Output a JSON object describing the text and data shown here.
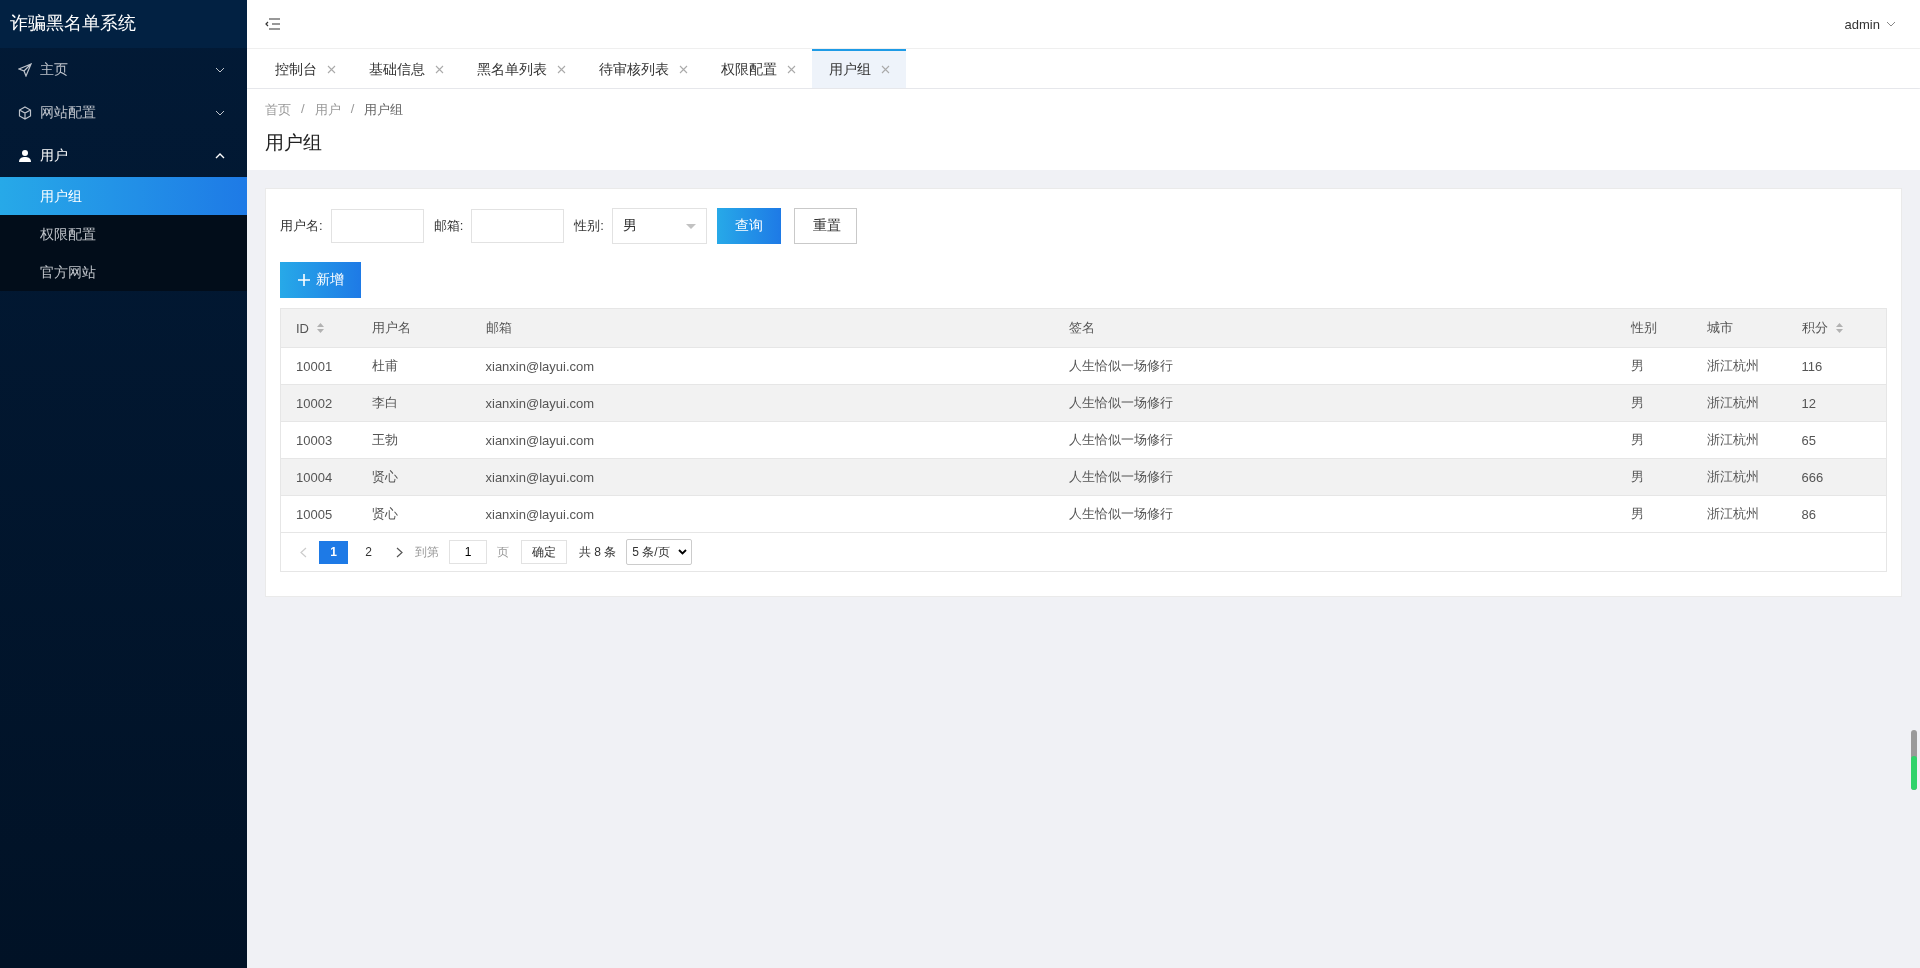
{
  "app": {
    "title": "诈骗黑名单系统"
  },
  "sidebar": {
    "items": [
      {
        "label": "主页",
        "expanded": false
      },
      {
        "label": "网站配置",
        "expanded": false
      },
      {
        "label": "用户",
        "expanded": true,
        "children": [
          {
            "label": "用户组",
            "selected": true
          },
          {
            "label": "权限配置",
            "selected": false
          },
          {
            "label": "官方网站",
            "selected": false
          }
        ]
      }
    ]
  },
  "header": {
    "user": "admin"
  },
  "tabs": [
    {
      "label": "控制台",
      "selected": false
    },
    {
      "label": "基础信息",
      "selected": false
    },
    {
      "label": "黑名单列表",
      "selected": false
    },
    {
      "label": "待审核列表",
      "selected": false
    },
    {
      "label": "权限配置",
      "selected": false
    },
    {
      "label": "用户组",
      "selected": true
    }
  ],
  "breadcrumb": [
    {
      "kind": "link",
      "text": "首页"
    },
    {
      "kind": "separator",
      "text": "/"
    },
    {
      "kind": "link",
      "text": "用户"
    },
    {
      "kind": "separator",
      "text": "/"
    },
    {
      "kind": "current",
      "text": "用户组"
    }
  ],
  "page_title": "用户组",
  "filters": [
    {
      "label": "用户名:",
      "kind": "text"
    },
    {
      "label": "邮箱:",
      "kind": "text"
    },
    {
      "label": "性别:",
      "kind": "select",
      "value": "男"
    }
  ],
  "query_button": "查询",
  "reset_button": "重置",
  "add_button": "新增",
  "table": {
    "columns": [
      {
        "label": "ID",
        "sortable": true
      },
      {
        "label": "用户名",
        "sortable": false
      },
      {
        "label": "邮箱",
        "sortable": false
      },
      {
        "label": "签名",
        "sortable": false
      },
      {
        "label": "性别",
        "sortable": false
      },
      {
        "label": "城市",
        "sortable": false
      },
      {
        "label": "积分",
        "sortable": true
      }
    ],
    "rows": [
      [
        "10001",
        "杜甫",
        "xianxin@layui.com",
        "人生恰似一场修行",
        "男",
        "浙江杭州",
        "116"
      ],
      [
        "10002",
        "李白",
        "xianxin@layui.com",
        "人生恰似一场修行",
        "男",
        "浙江杭州",
        "12"
      ],
      [
        "10003",
        "王勃",
        "xianxin@layui.com",
        "人生恰似一场修行",
        "男",
        "浙江杭州",
        "65"
      ],
      [
        "10004",
        "贤心",
        "xianxin@layui.com",
        "人生恰似一场修行",
        "男",
        "浙江杭州",
        "666"
      ],
      [
        "10005",
        "贤心",
        "xianxin@layui.com",
        "人生恰似一场修行",
        "男",
        "浙江杭州",
        "86"
      ]
    ]
  },
  "pagination": {
    "pages": [
      {
        "label": "1",
        "selected": true
      },
      {
        "label": "2",
        "selected": false
      }
    ],
    "goto_label": "到第",
    "goto_value": "1",
    "page_unit": "页",
    "confirm": "确定",
    "total": "共 8 条",
    "page_size": "5 条/页"
  }
}
